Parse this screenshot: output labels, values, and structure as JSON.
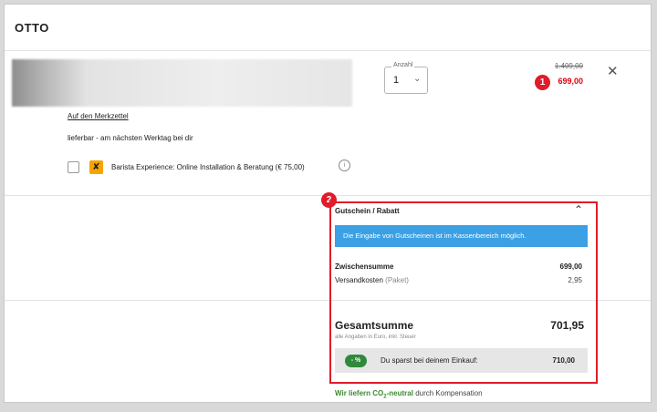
{
  "header": {
    "logo": "OTTO"
  },
  "cart_item": {
    "quantity_label": "Anzahl",
    "quantity_value": "1",
    "old_price": "1.409,00",
    "new_price": "699,00",
    "wishlist_link": "Auf den Merkzettel",
    "delivery_text": "lieferbar - am nächsten Werktag bei dir",
    "service_label": "Barista Experience: Online Installation & Beratung (€ 75,00)"
  },
  "badges": {
    "first": "1",
    "second": "2"
  },
  "summary": {
    "coupon_title": "Gutschein / Rabatt",
    "coupon_info": "Die Eingabe von Gutscheinen ist im Kassenbereich möglich.",
    "subtotal_label": "Zwischensumme",
    "subtotal_value": "699,00",
    "shipping_label": "Versandkosten",
    "shipping_type": "(Paket)",
    "shipping_value": "2,95",
    "total_label": "Gesamtsumme",
    "total_value": "701,95",
    "tax_note": "alle Angaben in Euro, inkl. Steuer",
    "savings_icon_text": "- %",
    "savings_label": "Du sparst bei deinem Einkauf:",
    "savings_value": "710,00"
  },
  "co2": {
    "prefix": "Wir liefern CO",
    "subscript": "2",
    "suffix": "-neutral",
    "rest": " durch Kompensation"
  },
  "colors": {
    "sale_red": "#e1000f",
    "banner_blue": "#3ba0e4",
    "badge_red": "#e01b2a",
    "eco_green": "#3a8a2e"
  }
}
